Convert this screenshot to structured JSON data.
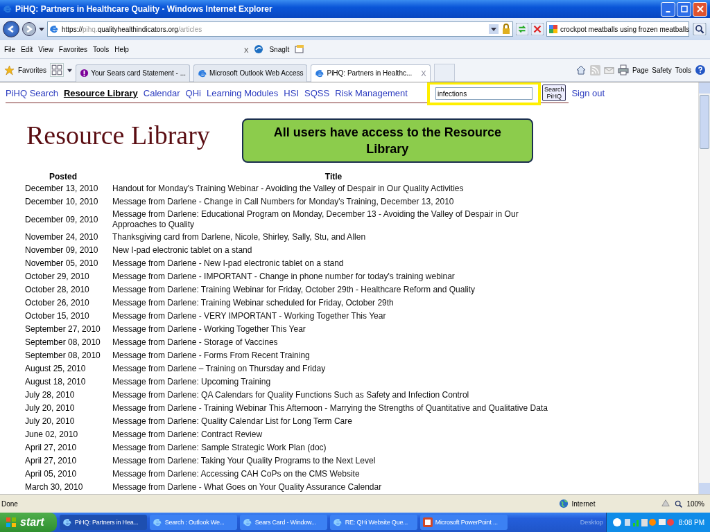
{
  "window": {
    "title": "PiHQ: Partners in Healthcare Quality - Windows Internet Explorer"
  },
  "address_bar": {
    "url_parts": [
      {
        "text": "https://",
        "dim": false
      },
      {
        "text": "pihq.",
        "dim": true
      },
      {
        "text": "qualityhealthindicators.org",
        "dim": false
      },
      {
        "text": "/articles",
        "dim": true
      }
    ],
    "search_value": "crockpot meatballs using frozen meatballs"
  },
  "menu": [
    "File",
    "Edit",
    "View",
    "Favorites",
    "Tools",
    "Help"
  ],
  "toolbar": {
    "close_mark": "x",
    "snagit": "SnagIt"
  },
  "favorites_bar": {
    "label": "Favorites",
    "tabs": [
      {
        "label": "Your Sears card Statement - ...",
        "selected": false,
        "closable": false
      },
      {
        "label": "Microsoft Outlook Web Access",
        "selected": false,
        "closable": false
      },
      {
        "label": "PiHQ: Partners in Healthc...",
        "selected": true,
        "closable": true
      }
    ],
    "tab_close": "X",
    "commands": [
      "Page",
      "Safety",
      "Tools"
    ]
  },
  "nav": {
    "links": [
      {
        "label": "PiHQ Search",
        "selected": false
      },
      {
        "label": "Resource Library",
        "selected": true
      },
      {
        "label": "Calendar",
        "selected": false
      },
      {
        "label": "QHi",
        "selected": false
      },
      {
        "label": "Learning Modules",
        "selected": false
      },
      {
        "label": "HSI",
        "selected": false
      },
      {
        "label": "SQSS",
        "selected": false
      },
      {
        "label": "Risk Management",
        "selected": false
      }
    ],
    "search_value": "infections",
    "search_button": "Search PiHQ",
    "sign_out": "Sign out"
  },
  "heading": "Resource Library",
  "callout": "All users have access to the Resource Library",
  "table": {
    "columns": [
      "Posted",
      "Title"
    ],
    "rows": [
      [
        "December 13, 2010",
        "Handout for Monday's Training Webinar - Avoiding the Valley of Despair in Our Quality Activities"
      ],
      [
        "December 10, 2010",
        "Message from Darlene - Change in Call Numbers for Monday's Training, December 13, 2010"
      ],
      [
        "December 09, 2010",
        "Message from Darlene: Educational Program on Monday, December 13 - Avoiding the Valley of Despair in Our Approaches to Quality"
      ],
      [
        "November 24, 2010",
        "Thanksgiving card from Darlene, Nicole, Shirley, Sally, Stu, and Allen"
      ],
      [
        "November 09, 2010",
        "New I-pad electronic tablet on a stand"
      ],
      [
        "November 05, 2010",
        "Message from Darlene - New I-pad electronic tablet on a stand"
      ],
      [
        "October 29, 2010",
        "Message from Darlene - IMPORTANT - Change in phone number for today's training webinar"
      ],
      [
        "October 28, 2010",
        "Message from Darlene: Training Webinar for Friday, October 29th - Healthcare Reform and Quality"
      ],
      [
        "October 26, 2010",
        "Message from Darlene: Training Webinar scheduled for Friday, October 29th"
      ],
      [
        "October 15, 2010",
        "Message from Darlene - VERY IMPORTANT - Working Together This Year"
      ],
      [
        "September 27, 2010",
        "Message from Darlene - Working Together This Year"
      ],
      [
        "September 08, 2010",
        "Message from Darlene - Storage of Vaccines"
      ],
      [
        "September 08, 2010",
        "Message from Darlene - Forms From Recent Training"
      ],
      [
        "August 25, 2010",
        "Message from Darlene – Training on Thursday and Friday"
      ],
      [
        "August 18, 2010",
        "Message from Darlene: Upcoming Training"
      ],
      [
        "July 28, 2010",
        "Message from Darlene: QA Calendars for Quality Functions Such as Safety and Infection Control"
      ],
      [
        "July 20, 2010",
        "Message from Darlene - Training Webinar This Afternoon - Marrying the Strengths of Quantitative and Qualitative Data"
      ],
      [
        "July 20, 2010",
        "Message from Darlene: Quality Calendar List for Long Term Care"
      ],
      [
        "June 02, 2010",
        "Message from Darlene: Contract Review"
      ],
      [
        "April 27, 2010",
        "Message from Darlene: Sample Strategic Work Plan (doc)"
      ],
      [
        "April 27, 2010",
        "Message from Darlene: Taking Your Quality Programs to the Next Level"
      ],
      [
        "April 05, 2010",
        "Message from Darlene: Accessing CAH CoPs on the CMS Website"
      ],
      [
        "March 30, 2010",
        "Message from Darlene - What Goes on Your Quality Assurance Calendar"
      ]
    ]
  },
  "status_bar": {
    "text": "Done",
    "zone": "Internet",
    "zoom": "100%"
  },
  "taskbar": {
    "start": "start",
    "items": [
      {
        "label": "PiHQ: Partners in Hea...",
        "selected": true,
        "kind": "ie"
      },
      {
        "label": "Search : Outlook We...",
        "selected": false,
        "kind": "ie"
      },
      {
        "label": "Sears Card - Window...",
        "selected": false,
        "kind": "ie"
      },
      {
        "label": "RE: QHi Website Que...",
        "selected": false,
        "kind": "ie"
      },
      {
        "label": "Microsoft PowerPoint ...",
        "selected": false,
        "kind": "ppt"
      }
    ],
    "desktop": "Desktop",
    "time": "8:08 PM"
  }
}
